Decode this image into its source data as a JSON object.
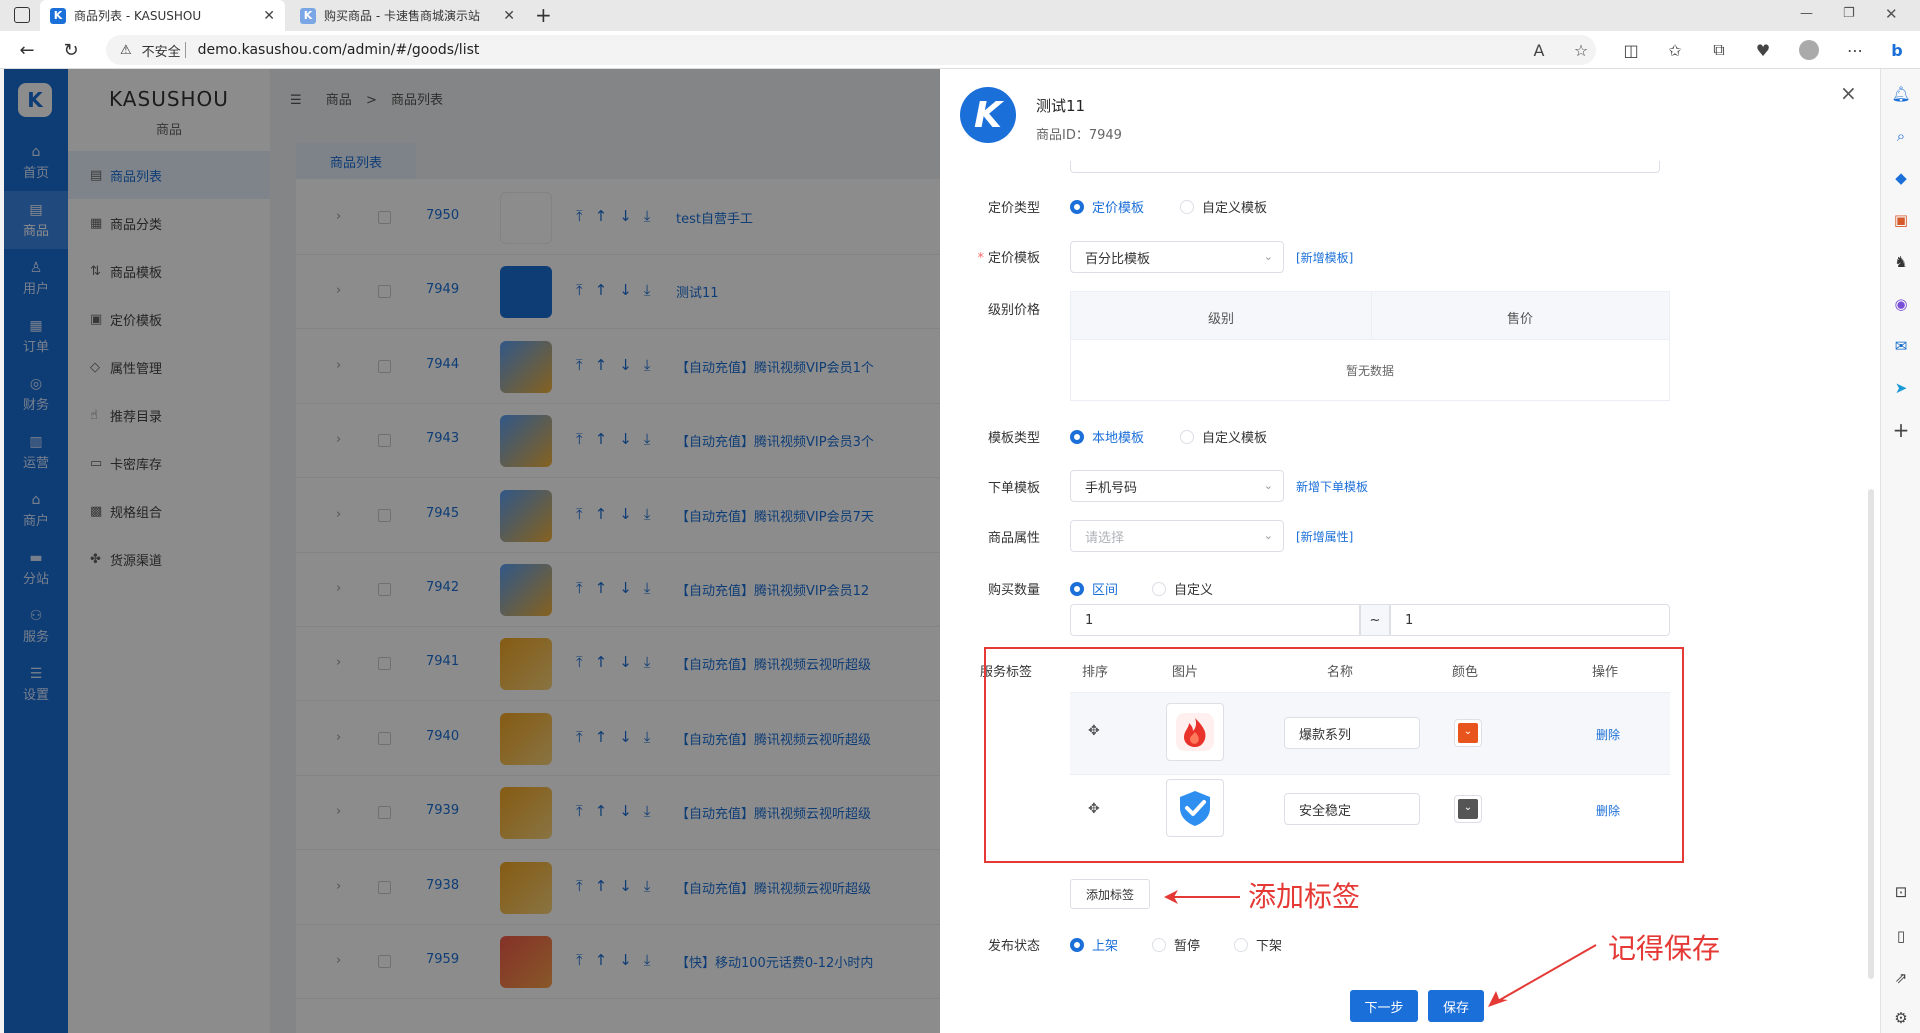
{
  "browser": {
    "tabs": [
      {
        "title": "商品列表 - KASUSHOU",
        "favicon": "K"
      },
      {
        "title": "购买商品 - 卡速售商城演示站",
        "favicon": "K"
      }
    ],
    "new_tab": "+",
    "security": "不安全",
    "url": "demo.kasushou.com/admin/#/goods/list"
  },
  "rail": {
    "logo": "K",
    "items": [
      "首页",
      "商品",
      "用户",
      "订单",
      "财务",
      "运营",
      "商户",
      "分站",
      "服务",
      "设置"
    ]
  },
  "submenu": {
    "brand": "KASUSHOU",
    "section": "商品",
    "items": [
      "商品列表",
      "商品分类",
      "商品模板",
      "定价模板",
      "属性管理",
      "推荐目录",
      "卡密库存",
      "规格组合",
      "货源渠道"
    ]
  },
  "breadcrumb": {
    "root": "商品",
    "sep": ">",
    "current": "商品列表"
  },
  "page_tab": "商品列表",
  "rows": [
    {
      "id": "7950",
      "name": "test自营手工",
      "img": "doodle"
    },
    {
      "id": "7949",
      "name": "测试11",
      "img": "k"
    },
    {
      "id": "7944",
      "name": "【自动充值】腾讯视频VIP会员1个",
      "img": "card-blue"
    },
    {
      "id": "7943",
      "name": "【自动充值】腾讯视频VIP会员3个",
      "img": "card-blue"
    },
    {
      "id": "7945",
      "name": "【自动充值】腾讯视频VIP会员7天",
      "img": "card-blue"
    },
    {
      "id": "7942",
      "name": "【自动充值】腾讯视频VIP会员12",
      "img": "card-blue"
    },
    {
      "id": "7941",
      "name": "【自动充值】腾讯视频云视听超级",
      "img": "card-orange"
    },
    {
      "id": "7940",
      "name": "【自动充值】腾讯视频云视听超级",
      "img": "card-orange"
    },
    {
      "id": "7939",
      "name": "【自动充值】腾讯视频云视听超级",
      "img": "card-orange"
    },
    {
      "id": "7938",
      "name": "【自动充值】腾讯视频云视听超级",
      "img": "card-orange"
    },
    {
      "id": "7959",
      "name": "【快】移动100元话费0-12小时内",
      "img": "card-red"
    }
  ],
  "drawer": {
    "logo": "K",
    "title": "测试11",
    "subtitle": "商品ID：7949",
    "close": "×",
    "pricing_type": {
      "label": "定价类型",
      "options": [
        "定价模板",
        "自定义模板"
      ],
      "selected": 0
    },
    "pricing_template": {
      "label": "定价模板",
      "value": "百分比模板",
      "link": "[新增模板]"
    },
    "level_price": {
      "label": "级别价格",
      "col_level": "级别",
      "col_price": "售价",
      "empty": "暂无数据"
    },
    "template_type": {
      "label": "模板类型",
      "options": [
        "本地模板",
        "自定义模板"
      ],
      "selected": 0
    },
    "order_template": {
      "label": "下单模板",
      "value": "手机号码",
      "link": "新增下单模板"
    },
    "attributes": {
      "label": "商品属性",
      "placeholder": "请选择",
      "link": "[新增属性]"
    },
    "buy_qty": {
      "label": "购买数量",
      "options": [
        "区间",
        "自定义"
      ],
      "selected": 0,
      "min": "1",
      "tilde": "~",
      "max": "1"
    },
    "service_tags": {
      "label": "服务标签",
      "cols": [
        "排序",
        "图片",
        "名称",
        "颜色",
        "操作"
      ],
      "rows": [
        {
          "name": "爆款系列",
          "color": "#e8551c",
          "icon": "fire-icon",
          "action": "删除"
        },
        {
          "name": "安全稳定",
          "color": "#555555",
          "icon": "shield-check-icon",
          "action": "删除"
        }
      ],
      "add_button": "添加标签"
    },
    "publish": {
      "label": "发布状态",
      "options": [
        "上架",
        "暂停",
        "下架"
      ],
      "selected": 0
    },
    "buttons": {
      "next": "下一步",
      "save": "保存"
    }
  },
  "annotations": {
    "add_tag": "添加标签",
    "remember_save": "记得保存",
    "color": "#e53935"
  }
}
